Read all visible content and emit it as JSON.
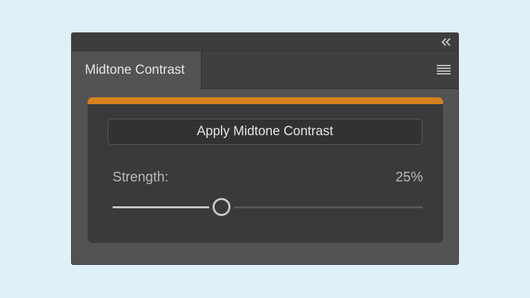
{
  "panel": {
    "tab_title": "Midtone Contrast",
    "collapse_icon": "double-chevron-left-icon",
    "menu_icon": "hamburger-menu-icon"
  },
  "content": {
    "accent_color": "#d4811e",
    "apply_button_label": "Apply Midtone Contrast",
    "strength_label": "Strength:",
    "strength_value": "25%",
    "strength_fraction": 0.35
  }
}
